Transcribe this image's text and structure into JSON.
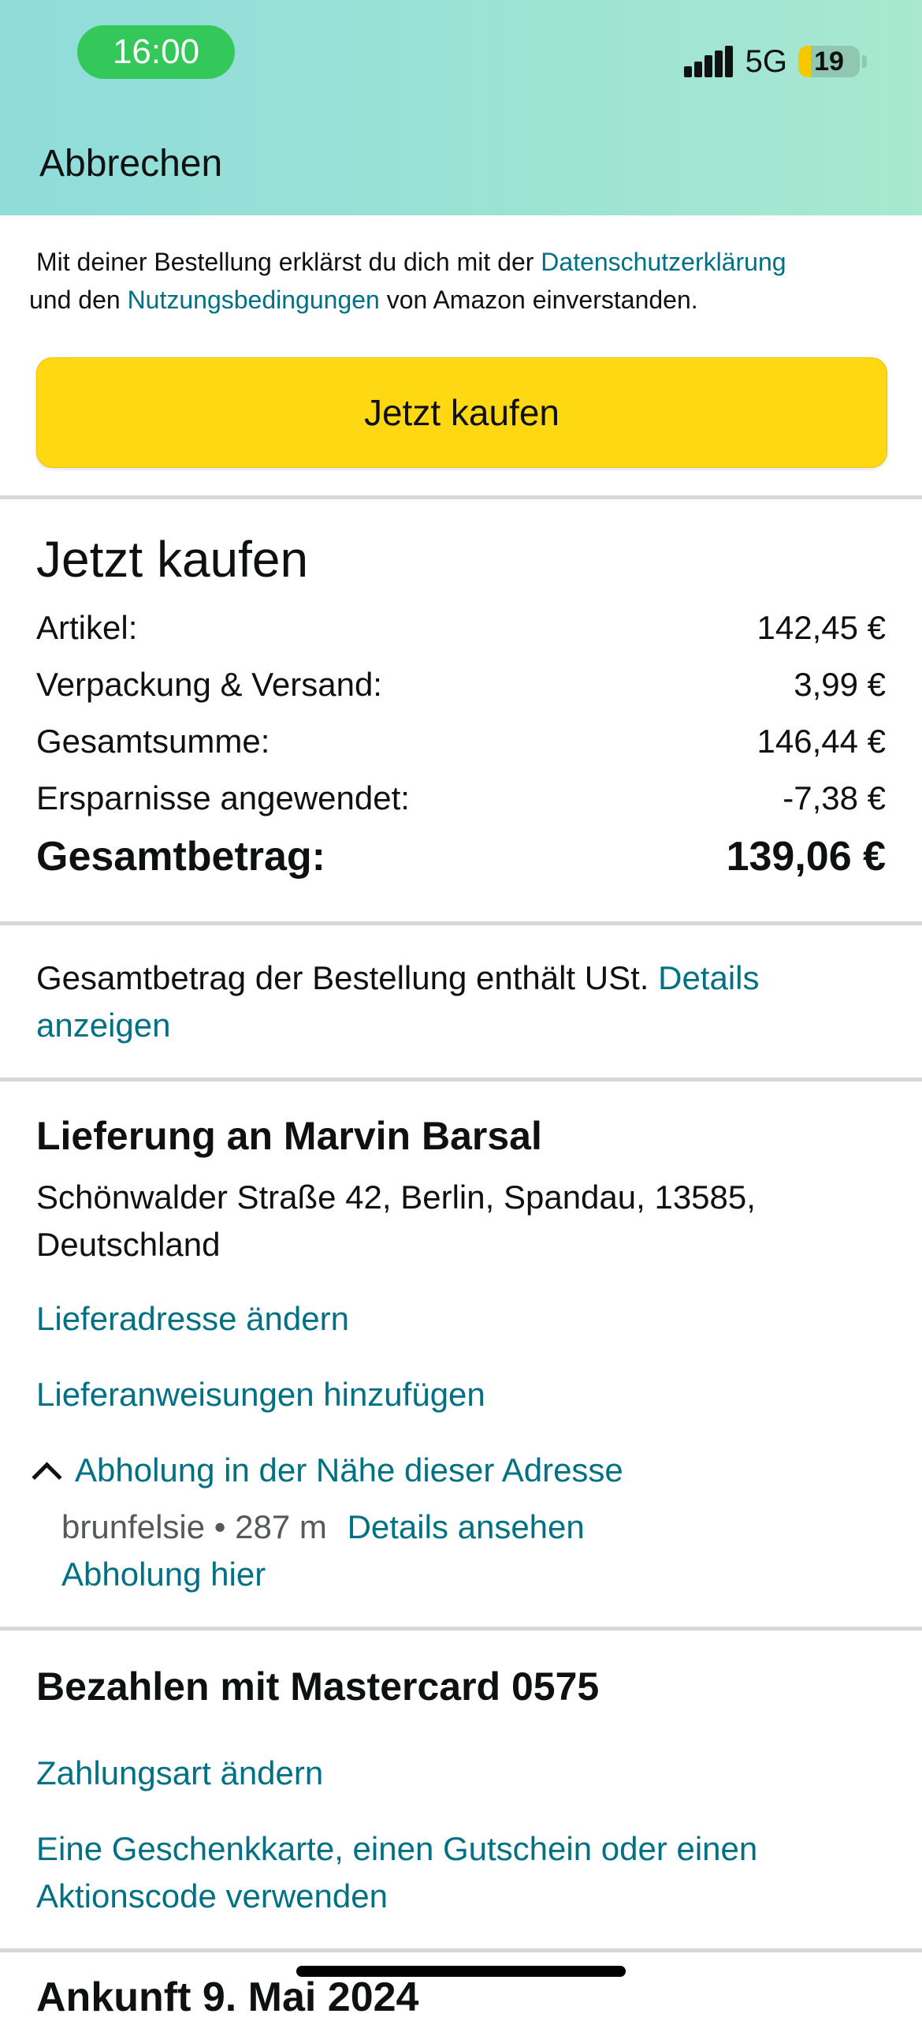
{
  "status_bar": {
    "time": "16:00",
    "network": "5G",
    "battery": "19"
  },
  "header": {
    "cancel_label": "Abbrechen"
  },
  "legal": {
    "text_1": "Mit deiner Bestellung erklärst du dich mit der ",
    "privacy_link": "Datenschutzerklärung",
    "text_2": " und den ",
    "terms_link": "Nutzungsbedingungen",
    "text_3": " von Amazon einverstanden."
  },
  "buy_button_label": "Jetzt kaufen",
  "summary": {
    "title": "Jetzt kaufen",
    "rows": [
      {
        "label": "Artikel:",
        "value": "142,45 €"
      },
      {
        "label": "Verpackung & Versand:",
        "value": "3,99 €"
      },
      {
        "label": "Gesamtsumme:",
        "value": "146,44 €"
      },
      {
        "label": "Ersparnisse angewendet:",
        "value": "-7,38 €"
      }
    ],
    "total_label": "Gesamtbetrag:",
    "total_value": "139,06 €"
  },
  "vat": {
    "text": "Gesamtbetrag der Bestellung enthält USt. ",
    "link": "Details anzeigen"
  },
  "delivery": {
    "title": "Lieferung an Marvin Barsal",
    "address": "Schönwalder Straße 42, Berlin, Spandau, 13585, Deutschland",
    "change_address": "Lieferadresse ändern",
    "add_instructions": "Lieferanweisungen hinzufügen",
    "pickup_toggle": "Abholung in der Nähe dieser Adresse",
    "pickup_name": "brunfelsie",
    "pickup_distance": "• 287 m",
    "pickup_details": "Details ansehen",
    "pickup_here": "Abholung hier"
  },
  "payment": {
    "title": "Bezahlen mit Mastercard 0575",
    "change_method": "Zahlungsart ändern",
    "gift_card": "Eine Geschenkkarte, einen Gutschein oder einen Aktionscode verwenden"
  },
  "next_section_partial": "Ankunft 9. Mai 2024"
}
